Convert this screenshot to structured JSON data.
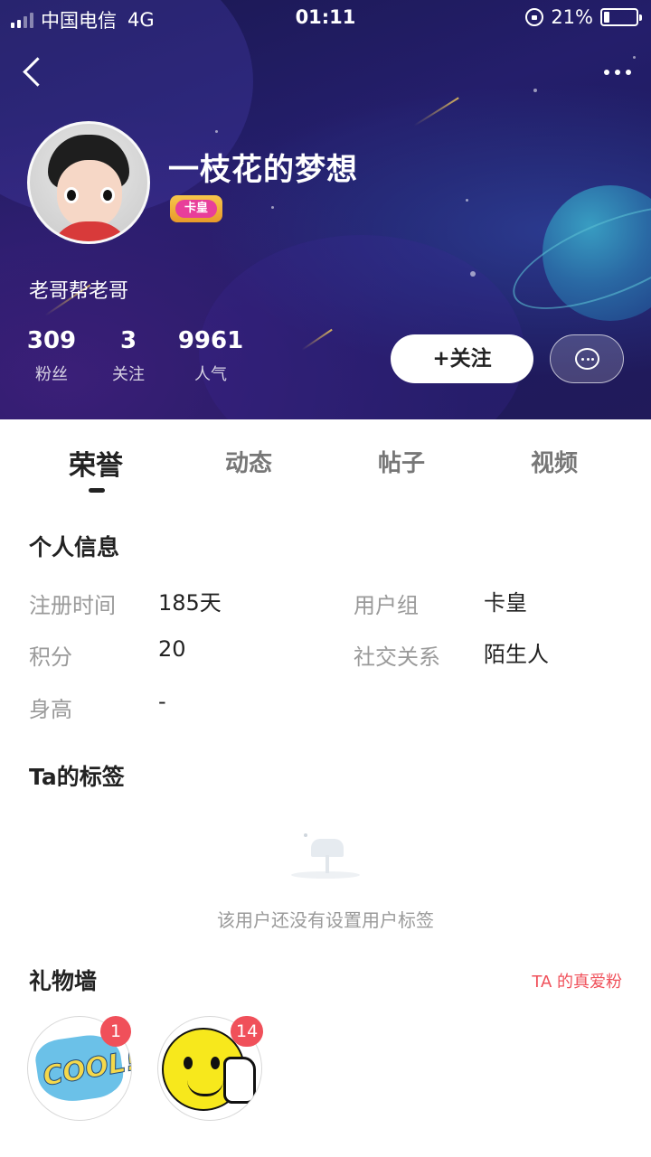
{
  "status_bar": {
    "carrier": "中国电信",
    "network": "4G",
    "time": "01:11",
    "battery": "21%"
  },
  "profile": {
    "name": "一枝花的梦想",
    "badge": "卡皇",
    "bio": "老哥帮老哥",
    "stats": [
      {
        "value": "309",
        "label": "粉丝"
      },
      {
        "value": "3",
        "label": "关注"
      },
      {
        "value": "9961",
        "label": "人气"
      }
    ],
    "follow_label": "+关注"
  },
  "tabs": [
    {
      "label": "荣誉",
      "active": true
    },
    {
      "label": "动态",
      "active": false
    },
    {
      "label": "帖子",
      "active": false
    },
    {
      "label": "视频",
      "active": false
    }
  ],
  "personal_info": {
    "title": "个人信息",
    "reg_time_key": "注册时间",
    "reg_time_val": "185天",
    "group_key": "用户组",
    "group_val": "卡皇",
    "points_key": "积分",
    "points_val": "20",
    "relation_key": "社交关系",
    "relation_val": "陌生人",
    "height_key": "身高",
    "height_val": "-"
  },
  "tags": {
    "title": "Ta的标签",
    "empty_text": "该用户还没有设置用户标签"
  },
  "gift_wall": {
    "title": "礼物墙",
    "fans_link": "TA 的真爱粉",
    "gifts": [
      {
        "name": "cool-sticker",
        "count": "1"
      },
      {
        "name": "thumbs-up-smiley",
        "count": "14"
      }
    ]
  },
  "colors": {
    "accent_red": "#f0505a",
    "header_bg": "#211a5a"
  }
}
